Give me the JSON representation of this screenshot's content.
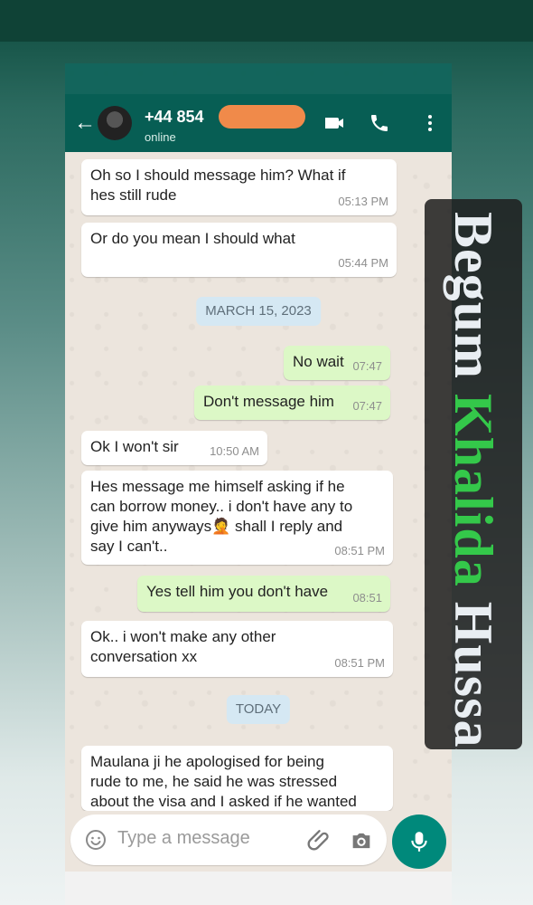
{
  "header": {
    "phone_number": "+44 854",
    "status": "online"
  },
  "messages": [
    {
      "text": "Oh so I should message him? What if\nhes still rude",
      "time": "05:13 PM",
      "direction": "in"
    },
    {
      "text": "Or do you mean I should what",
      "time": "05:44 PM",
      "direction": "in"
    },
    {
      "date": "MARCH 15, 2023"
    },
    {
      "text": "No wait",
      "time": "07:47",
      "direction": "out"
    },
    {
      "text": "Don't message him",
      "time": "07:47",
      "direction": "out"
    },
    {
      "text": "Ok I won't sir",
      "time": "10:50 AM",
      "direction": "in"
    },
    {
      "text": "Hes message me himself asking if he\ncan borrow money.. i don't have any to\ngive him anyways🤦 shall I reply and\nsay I can't..",
      "time": "08:51 PM",
      "direction": "in"
    },
    {
      "text": "Yes tell him you don't have",
      "time": "08:51",
      "direction": "out"
    },
    {
      "text": "Ok.. i won't make any other\nconversation xx",
      "time": "08:51 PM",
      "direction": "in"
    },
    {
      "date": "TODAY"
    },
    {
      "text": "Maulana ji he apologised for being\nrude to me, he said he was stressed\nabout the visa and I asked if he wanted",
      "time": "",
      "direction": "in"
    }
  ],
  "composer": {
    "placeholder": "Type a message"
  },
  "watermark": {
    "part1": "Begum ",
    "part2": "Khalida ",
    "part3": "Hussain"
  },
  "colors": {
    "accent": "#075e54",
    "outgoing_bubble": "#dcf8c6",
    "incoming_bubble": "#ffffff",
    "mic_button": "#00897b"
  },
  "icons": [
    "back-arrow-icon",
    "avatar-icon",
    "video-icon",
    "call-icon",
    "menu-icon",
    "emoji-icon",
    "attach-icon",
    "camera-icon",
    "mic-icon"
  ]
}
